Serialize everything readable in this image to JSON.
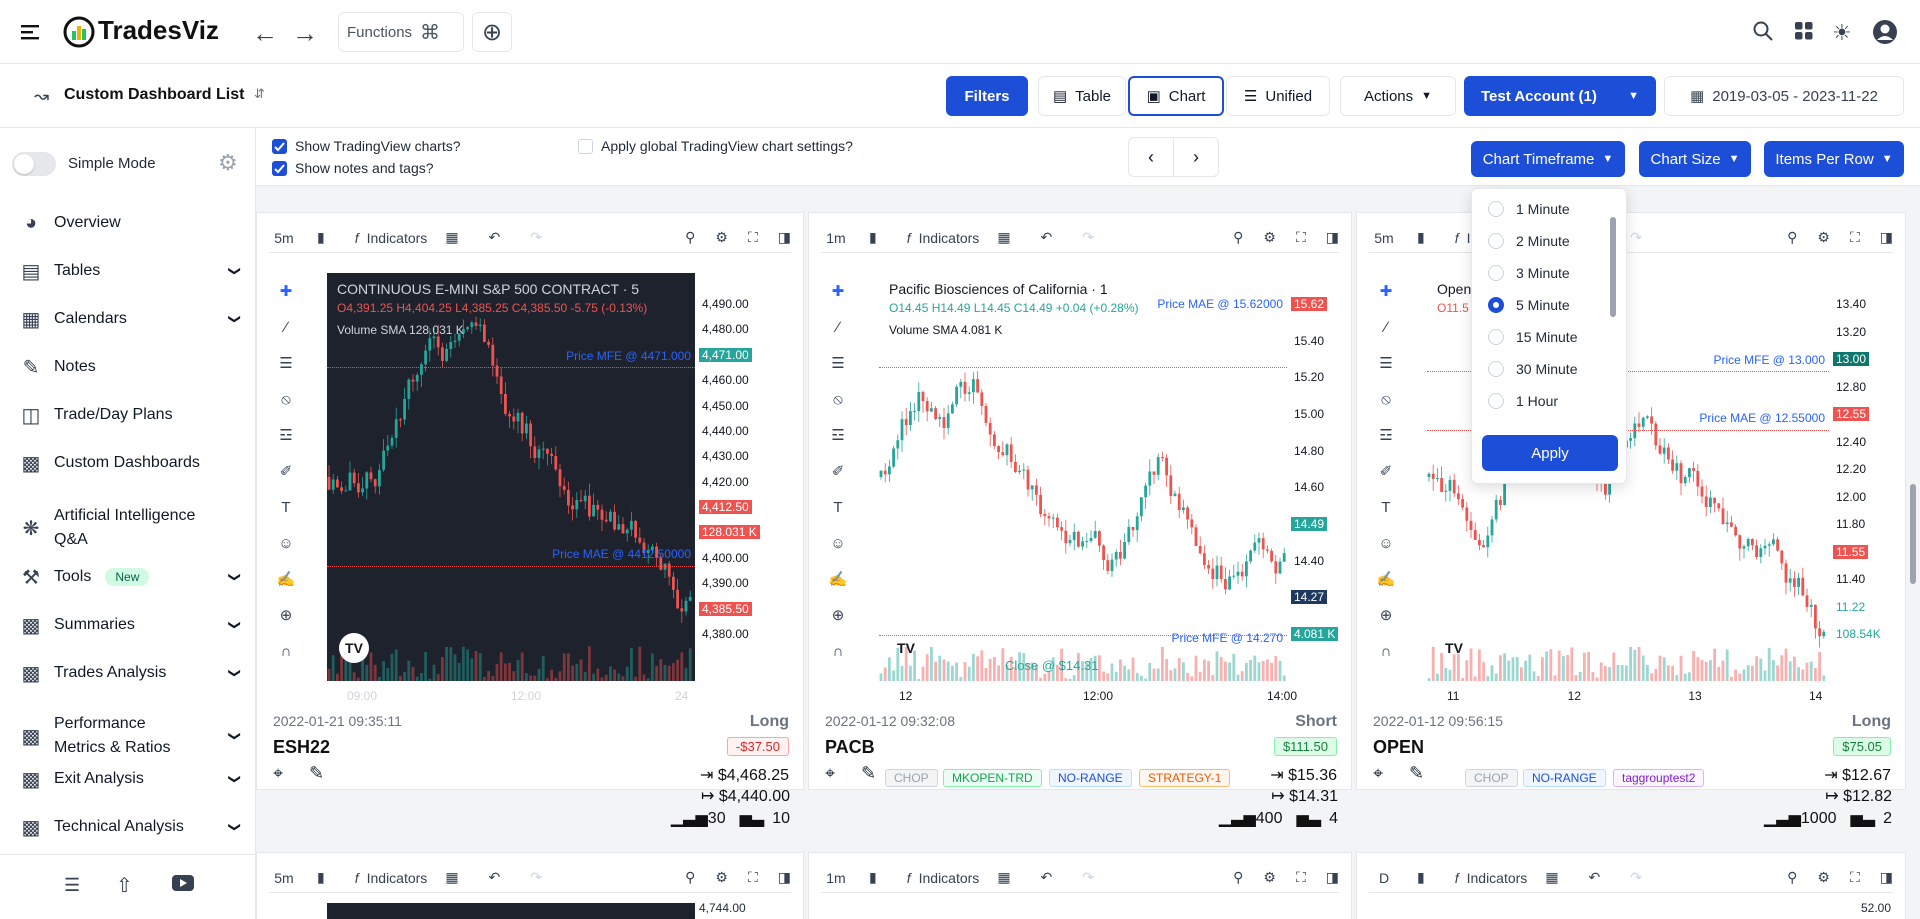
{
  "app": {
    "name": "TradesViz",
    "functions_label": "Functions"
  },
  "header": {
    "dashboard_title": "Custom Dashboard List",
    "filters": "Filters",
    "view_table": "Table",
    "view_chart": "Chart",
    "view_unified": "Unified",
    "actions": "Actions",
    "account": "Test Account (1)",
    "date_range": "2019-03-05 - 2023-11-22"
  },
  "sidebar": {
    "simple_mode": "Simple Mode",
    "items": [
      {
        "label": "Overview",
        "chevron": false
      },
      {
        "label": "Tables",
        "chevron": true
      },
      {
        "label": "Calendars",
        "chevron": true
      },
      {
        "label": "Notes",
        "chevron": false
      },
      {
        "label": "Trade/Day Plans",
        "chevron": false
      },
      {
        "label": "Custom Dashboards",
        "chevron": false
      },
      {
        "label": "Artificial Intelligence",
        "label2": "Q&A",
        "chevron": false
      },
      {
        "label": "Tools",
        "badge": "New",
        "chevron": true
      },
      {
        "label": "Summaries",
        "chevron": true
      },
      {
        "label": "Trades Analysis",
        "chevron": true
      },
      {
        "label": "Performance",
        "label2": "Metrics & Ratios",
        "chevron": true
      },
      {
        "label": "Exit Analysis",
        "chevron": true
      },
      {
        "label": "Technical Analysis",
        "chevron": true
      }
    ]
  },
  "options": {
    "show_tv": "Show TradingView charts?",
    "show_notes": "Show notes and tags?",
    "apply_global": "Apply global TradingView chart settings?",
    "chart_timeframe": "Chart Timeframe",
    "chart_size": "Chart Size",
    "items_per_row": "Items Per Row"
  },
  "timeframe_dropdown": {
    "options": [
      "1 Minute",
      "2 Minute",
      "3 Minute",
      "5 Minute",
      "15 Minute",
      "30 Minute",
      "1 Hour"
    ],
    "selected": "5 Minute",
    "apply": "Apply"
  },
  "toolbar": {
    "indicators": "Indicators"
  },
  "trades": [
    {
      "interval": "5m",
      "title": "CONTINUOUS E-MINI S&P 500 CONTRACT · 5",
      "ohlc": "O4,391.25 H4,404.25 L4,385.25 C4,385.50 -5.75 (-0.13%)",
      "vol": "Volume SMA  128.031 K",
      "mfe": "Price MFE @ 4471.000",
      "mae": "Price MAE @ 4412.50000",
      "prices": [
        "4,490.00",
        "4,480.00",
        "4,471.00",
        "4,460.00",
        "4,450.00",
        "4,440.00",
        "4,430.00",
        "4,420.00",
        "4,412.50",
        "128.031 K",
        "4,400.00",
        "4,390.00",
        "4,385.50",
        "4,380.00"
      ],
      "xlabels": [
        "09:00",
        "12:00",
        "24"
      ],
      "date": "2022-01-21 09:35:11",
      "side": "Long",
      "symbol": "ESH22",
      "pnl": "-$37.50",
      "entry": "$4,468.25",
      "exit": "$4,440.00",
      "qty": "30",
      "qty2": "10",
      "tags": []
    },
    {
      "interval": "1m",
      "title": "Pacific Biosciences of California · 1",
      "ohlc": "O14.45 H14.49 L14.45 C14.49 +0.04 (+0.28%)",
      "vol": "Volume SMA  4.081 K",
      "mfe": "Price MFE @ 14.270",
      "mae": "Price MAE @ 15.62000",
      "close_label": "Close @ $14.31",
      "prices": [
        "15.62",
        "15.40",
        "15.20",
        "15.00",
        "14.80",
        "14.60",
        "14.49",
        "14.40",
        "14.27",
        "4.081 K"
      ],
      "xlabels": [
        "12",
        "12:00",
        "14:00"
      ],
      "date": "2022-01-12 09:32:08",
      "side": "Short",
      "symbol": "PACB",
      "pnl": "$111.50",
      "entry": "$15.36",
      "exit": "$14.31",
      "qty": "400",
      "qty2": "4",
      "tags": [
        "CHOP",
        "MKOPEN-TRD",
        "NO-RANGE",
        "STRATEGY-1"
      ]
    },
    {
      "interval": "5m",
      "title": "Open ... · 5",
      "ohlc": "O11.5 ... -0.01 (-0.13%)",
      "mfe": "Price MFE @ 13.000",
      "mae": "Price MAE @ 12.55000",
      "prices": [
        "13.40",
        "13.20",
        "13.00",
        "12.80",
        "12.55",
        "12.40",
        "12.20",
        "12.00",
        "11.80",
        "11.55",
        "11.40",
        "11.22",
        "108.54K"
      ],
      "xlabels": [
        "11",
        "12",
        "13",
        "14"
      ],
      "date": "2022-01-12 09:56:15",
      "side": "Long",
      "symbol": "OPEN",
      "pnl": "$75.05",
      "entry": "$12.67",
      "exit": "$12.82",
      "qty": "1000",
      "qty2": "2",
      "tags": [
        "CHOP",
        "NO-RANGE",
        "taggrouptest2"
      ]
    }
  ],
  "row2_intervals": [
    "5m",
    "1m",
    "D"
  ],
  "row2_price": "4,744.00",
  "row2_price3": "52.00",
  "colors": {
    "accent": "#1d4ed8",
    "up": "#26a69a",
    "down": "#ef5350"
  }
}
